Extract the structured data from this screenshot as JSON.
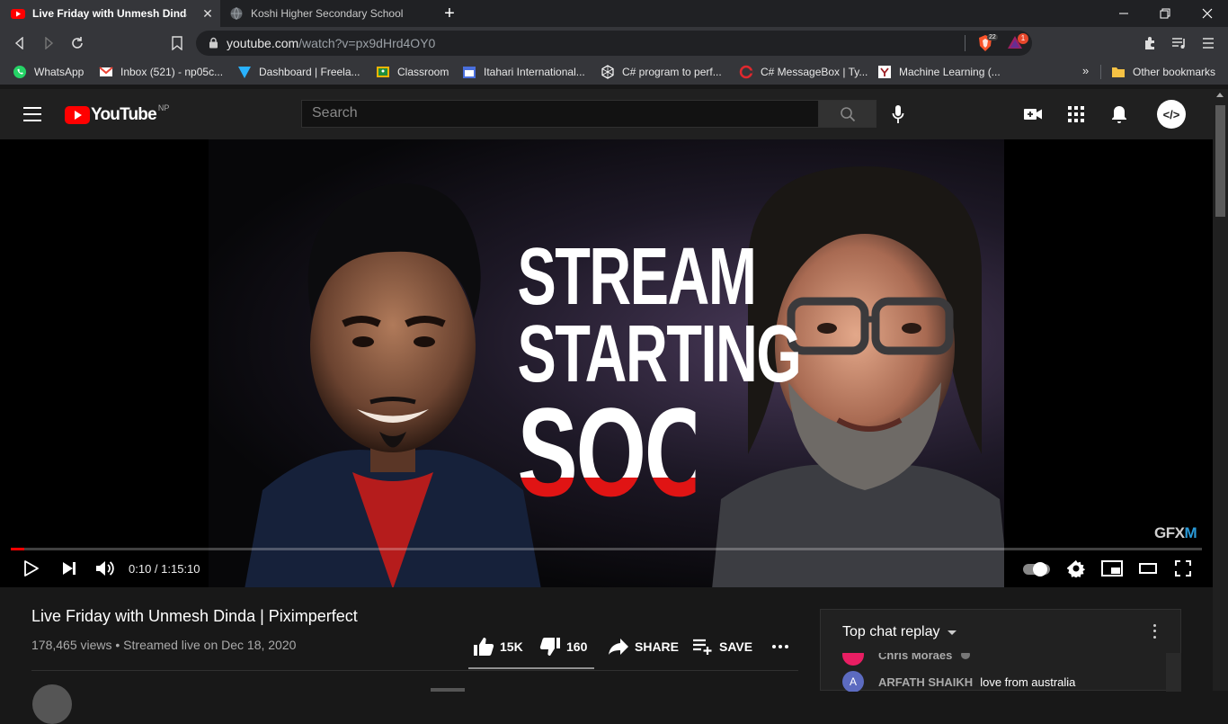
{
  "browser": {
    "tabs": [
      {
        "title": "Live Friday with Unmesh Dinda | P",
        "active": true
      },
      {
        "title": "Koshi Higher Secondary School",
        "active": false
      }
    ],
    "address": {
      "host": "youtube.com",
      "path": "/watch?v=px9dHrd4OY0"
    },
    "brave_badge": "22",
    "rewards_badge": "1",
    "bookmarks": [
      {
        "label": "WhatsApp",
        "color": "#25d366"
      },
      {
        "label": "Inbox (521) - np05c...",
        "color": "#ea4335"
      },
      {
        "label": "Dashboard | Freela...",
        "color": "#1f57c3"
      },
      {
        "label": "Classroom",
        "color": "#f4b400"
      },
      {
        "label": "Itahari International...",
        "color": "#4a6fdc"
      },
      {
        "label": "C# program to perf...",
        "color": "#ffffff"
      },
      {
        "label": "C# MessageBox | Ty...",
        "color": "#e0282e"
      },
      {
        "label": "Machine Learning (...",
        "color": "#ffffff"
      }
    ],
    "more_bookmarks": "»",
    "other_bookmarks": "Other bookmarks"
  },
  "youtube": {
    "logo_text": "YouTube",
    "country_code": "NP",
    "search_placeholder": "Search",
    "avatar_text": "</>"
  },
  "player": {
    "thumbnail_text": {
      "line1": "STREAM",
      "line2": "STARTING",
      "line3": "SOON"
    },
    "watermark": {
      "main": "GFX",
      "accent": "M"
    },
    "time": "0:10 / 1:15:10",
    "progress": 0.0022
  },
  "video": {
    "title": "Live Friday with Unmesh Dinda | Piximperfect",
    "meta": "178,465 views • Streamed live on Dec 18, 2020",
    "likes": "15K",
    "dislikes": "160",
    "share_label": "SHARE",
    "save_label": "SAVE"
  },
  "chat": {
    "header": "Top chat replay",
    "messages": [
      {
        "author": "Chris Moraes",
        "text": "",
        "avatar_letter": "",
        "avatar_color": "#e91e63"
      },
      {
        "author": "ARFATH SHAIKH",
        "text": "love from australia",
        "avatar_letter": "A",
        "avatar_color": "#5c6bc0"
      }
    ]
  },
  "colors": {
    "brand_red": "#ff0000",
    "bg_dark": "#181818",
    "header": "#202020"
  }
}
